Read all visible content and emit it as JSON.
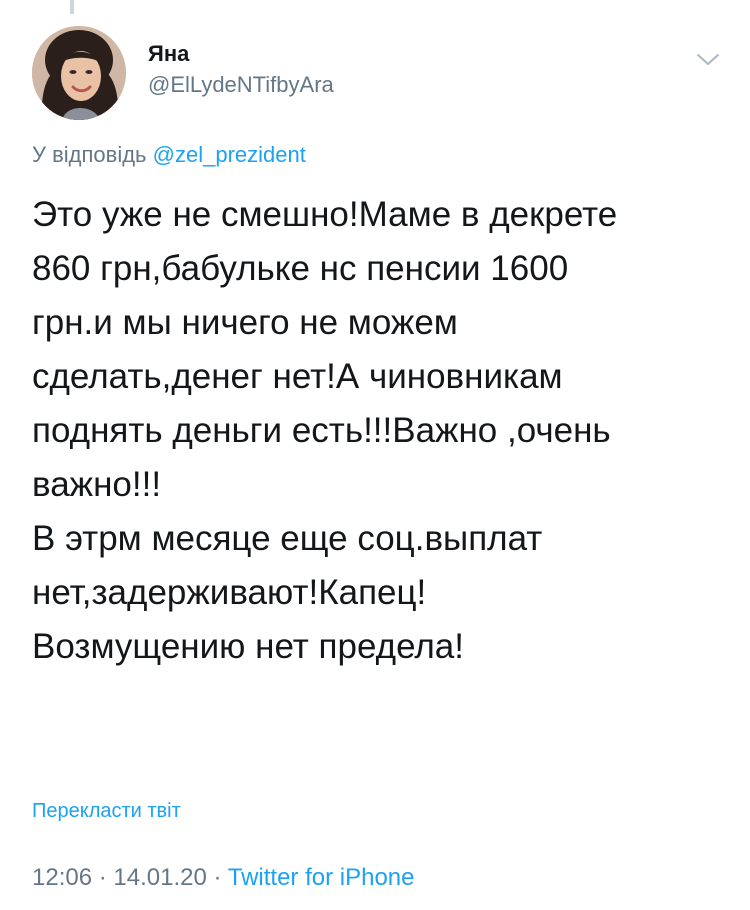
{
  "tweet": {
    "author": {
      "display_name": "Яна",
      "handle": "@ElLydeNTifbyAra"
    },
    "reply": {
      "prefix": "У відповідь",
      "mention": "@zel_prezident"
    },
    "text_lines": [
      "Это уже не смешно!Маме в декрете",
      "860 грн,бабульке нс пенсии 1600",
      "грн.и мы ничего не можем",
      "сделать,денег нет!А чиновникам",
      "поднять деньги есть!!!Важно ,очень",
      "важно!!!",
      "В этрм месяце еще соц.выплат",
      "нет,задерживают!Капец!",
      "Возмущению нет предела!"
    ],
    "translate_label": "Перекласти твіт",
    "time": "12:06",
    "separator": "·",
    "date": "14.01.20",
    "source": "Twitter for iPhone"
  },
  "icons": {
    "menu": "chevron-down-icon",
    "avatar": "avatar"
  },
  "colors": {
    "accent": "#1da1f2",
    "secondary_text": "#657786",
    "primary_text": "#14171a",
    "background": "#ffffff"
  }
}
